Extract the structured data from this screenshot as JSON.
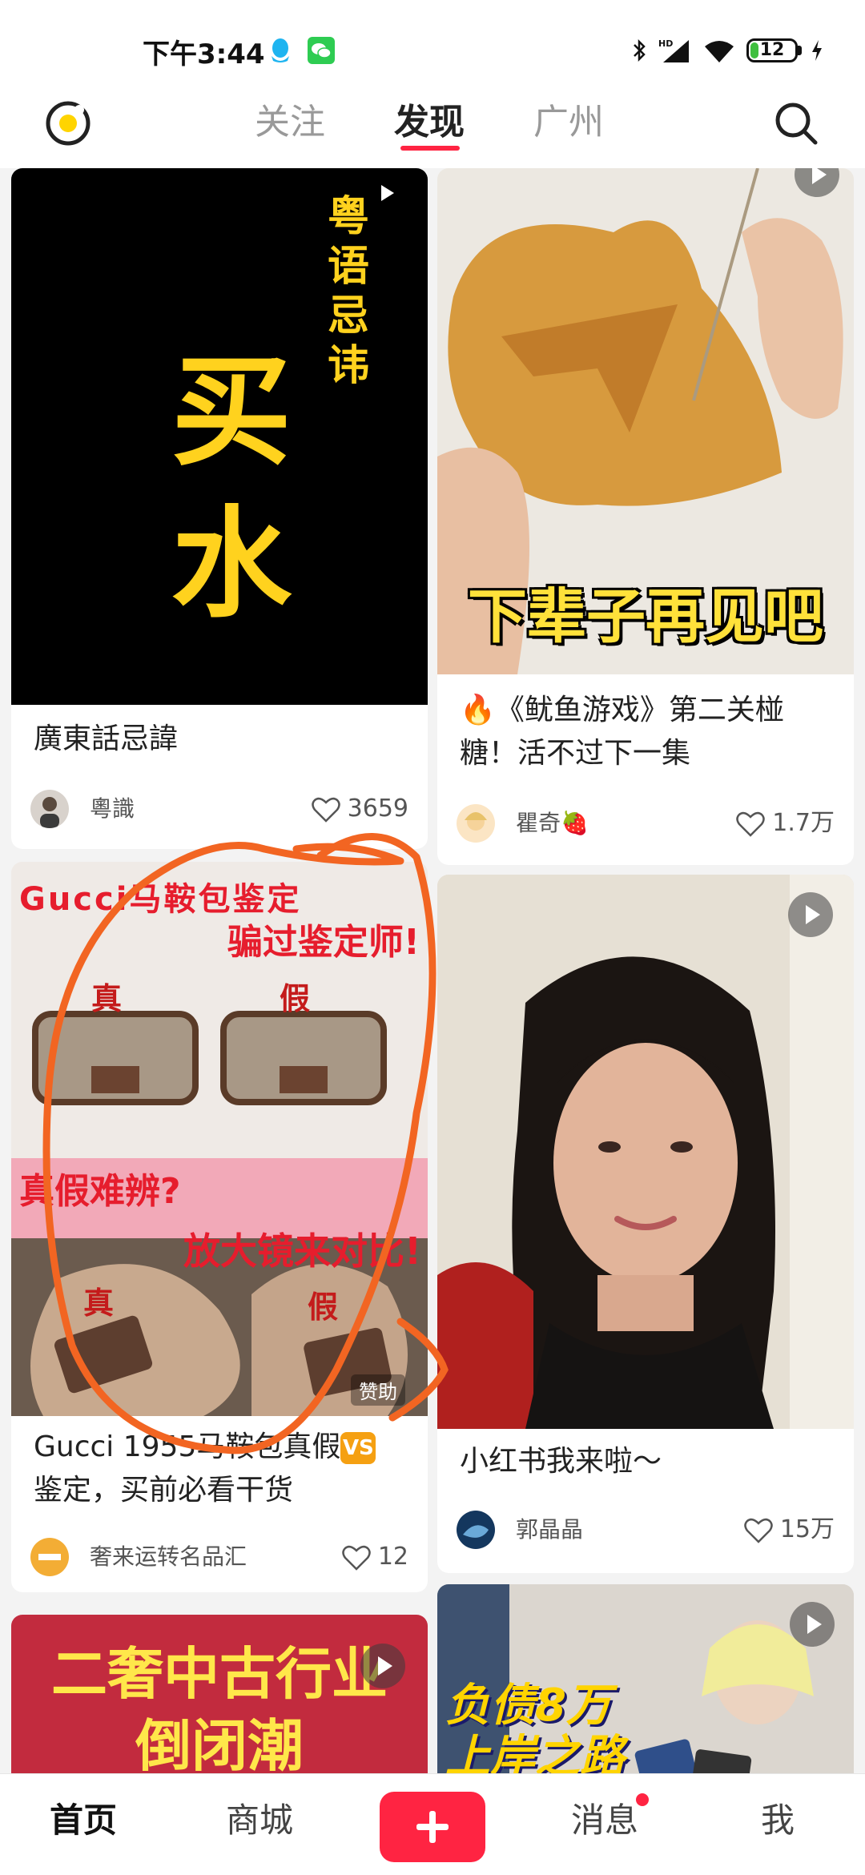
{
  "status_bar": {
    "time": "下午3:44",
    "battery": "12"
  },
  "top_nav": {
    "tabs": [
      {
        "label": "关注",
        "active": false
      },
      {
        "label": "发现",
        "active": true
      },
      {
        "label": "广州",
        "active": false
      }
    ]
  },
  "feed": [
    {
      "cover_text": {
        "side": "粤语忌讳",
        "main": "买水"
      },
      "title": "廣東話忌諱",
      "author": "粵識",
      "likes": "3659"
    },
    {
      "cover_text": {
        "caption": "下辈子再见吧"
      },
      "title": "🔥《鱿鱼游戏》第二关椪糖！活不过下一集",
      "author": "瞿奇🍓",
      "likes": "1.7万"
    },
    {
      "cover_text": {
        "headline": "Gucci马鞍包鉴定",
        "subheadline": "骗过鉴定师!",
        "label_real": "真",
        "label_fake": "假",
        "mid_a": "真假难辨?",
        "mid_b": "放大镜来对比!",
        "sponsor": "赞助"
      },
      "title": "Gucci 1955马鞍包真假",
      "title_badge": "VS",
      "title_line2": "鉴定，买前必看干货",
      "author": "奢来运转名品汇",
      "likes": "12"
    },
    {
      "title": "小红书我来啦～",
      "author": "郭晶晶",
      "likes": "15万"
    },
    {
      "cover_text": {
        "line1": "二奢中古行业",
        "line2": "倒闭潮"
      }
    },
    {
      "cover_text": {
        "line1": "负债8万",
        "line2": "上岸之路"
      }
    }
  ],
  "bottom_nav": {
    "home": "首页",
    "mall": "商城",
    "messages": "消息",
    "me": "我"
  },
  "colors": {
    "accent": "#ff2442",
    "annotation": "#f26522",
    "poster_yellow": "#ffd21e"
  },
  "icons": [
    "qq-icon",
    "wechat-icon",
    "bluetooth-icon",
    "signal-icon",
    "wifi-icon",
    "battery-icon",
    "charging-icon",
    "logo-icon",
    "search-icon",
    "heart-icon",
    "play-icon",
    "plus-icon"
  ]
}
